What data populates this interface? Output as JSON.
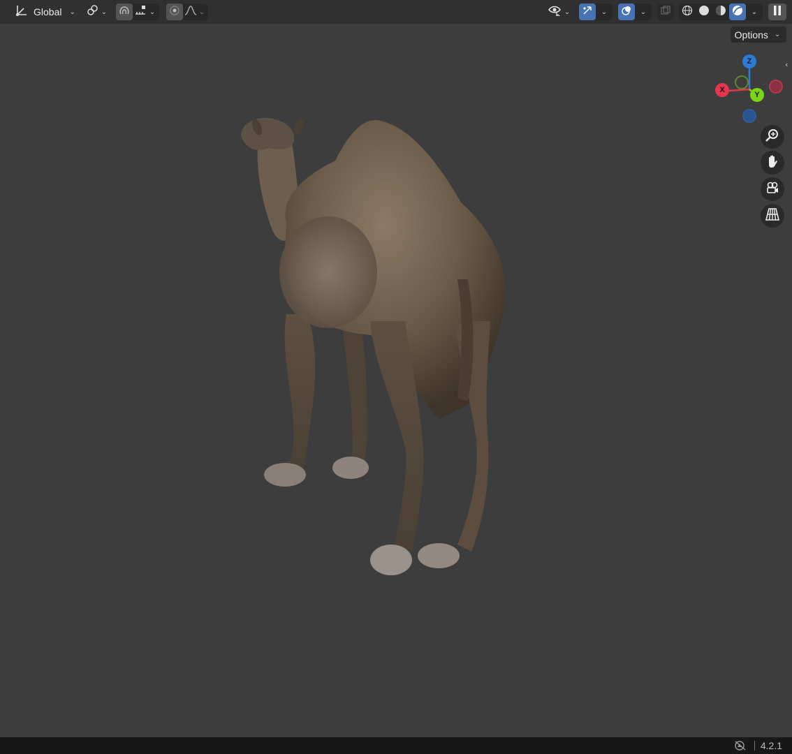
{
  "header": {
    "transform_orientation": "Global",
    "icons": {
      "orientation": "transform-orientation-icon",
      "pivot": "pivot-point-icon",
      "snap": "snap-magnet-icon",
      "snap_target": "snap-increment-icon",
      "proportional": "proportional-editing-icon",
      "falloff": "falloff-curve-icon",
      "visibility": "selectability-visibility-icon",
      "gizmo": "viewport-gizmo-icon",
      "overlays": "overlays-icon",
      "xray": "xray-icon",
      "shading_wire": "wireframe-shading-icon",
      "shading_solid": "solid-shading-icon",
      "shading_material": "material-preview-icon",
      "shading_rendered": "rendered-shading-icon",
      "pause": "pause-render-icon"
    }
  },
  "options_label": "Options",
  "gizmo": {
    "z_label": "Z",
    "x_label": "X",
    "y_label": "Y",
    "colors": {
      "x": "#e4364f",
      "y": "#7ad419",
      "z": "#2c7bd6"
    }
  },
  "nav_buttons": [
    "zoom-icon",
    "pan-hand-icon",
    "camera-view-icon",
    "perspective-grid-icon"
  ],
  "statusbar": {
    "version": "4.2.1"
  },
  "viewport": {
    "background": "#3d3d3d",
    "subject": "camel-3d-model"
  }
}
